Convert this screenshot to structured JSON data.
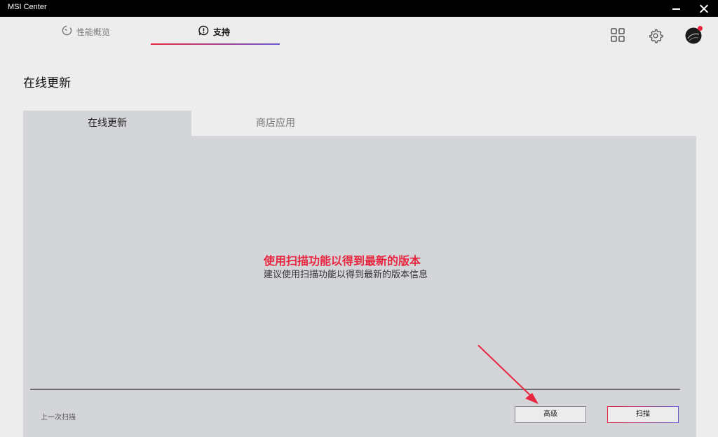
{
  "window": {
    "title": "MSI Center"
  },
  "nav": {
    "tabs": [
      {
        "label": "性能概览",
        "icon": "gauge-icon",
        "active": false
      },
      {
        "label": "支持",
        "icon": "alert-bubble-icon",
        "active": true
      }
    ],
    "icons": [
      "grid-icon",
      "gear-icon",
      "avatar-icon"
    ],
    "accent_gradient": [
      "#e8263f",
      "#6a5acd"
    ]
  },
  "page": {
    "title": "在线更新"
  },
  "subtabs": [
    {
      "label": "在线更新",
      "active": true
    },
    {
      "label": "商店应用",
      "active": false
    }
  ],
  "content": {
    "message_title": "使用扫描功能以得到最新的版本",
    "message_subtitle": "建议使用扫描功能以得到最新的版本信息",
    "last_scan_label": "上一次扫描"
  },
  "buttons": {
    "advanced": "高级",
    "scan": "扫描"
  },
  "colors": {
    "accent": "#e8263f",
    "panel": "#d4d5d9",
    "annotation_arrow": "#e8263f"
  }
}
